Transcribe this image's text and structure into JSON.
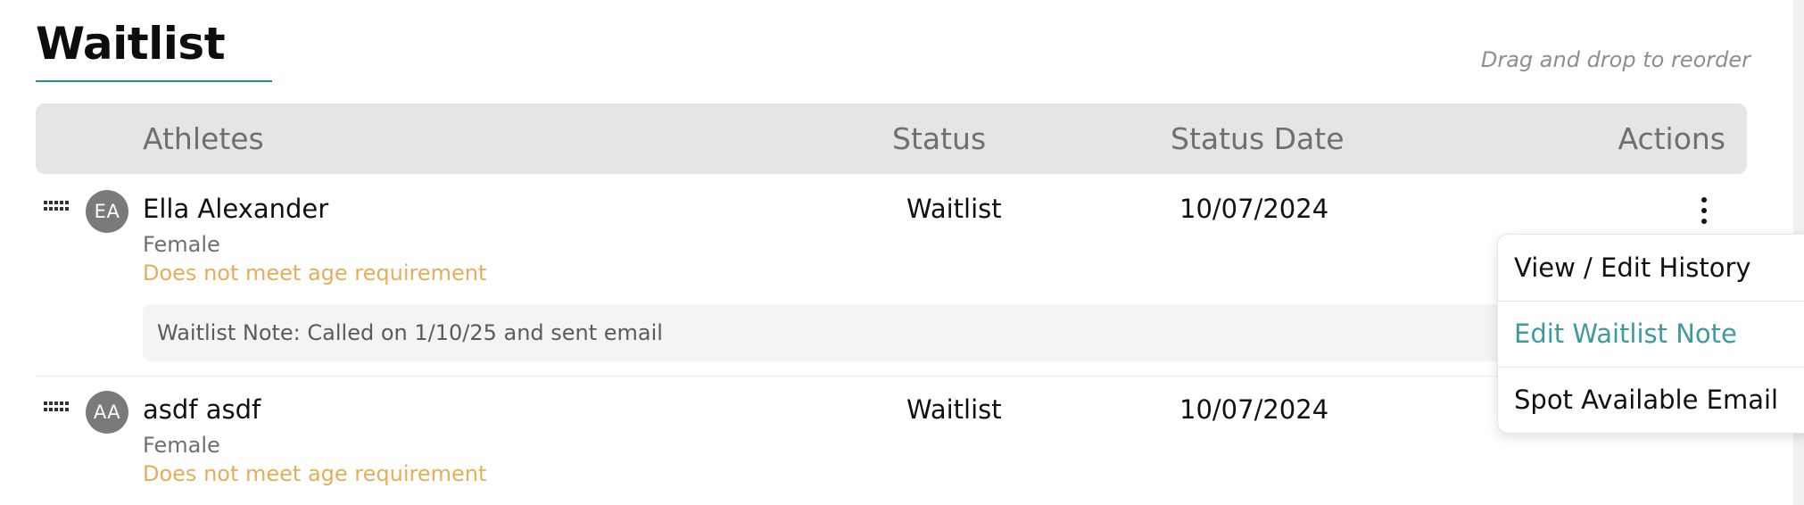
{
  "header": {
    "title": "Waitlist",
    "reorder_hint": "Drag and drop to reorder"
  },
  "table": {
    "columns": {
      "athletes": "Athletes",
      "status": "Status",
      "status_date": "Status Date",
      "actions": "Actions"
    },
    "rows": [
      {
        "initials": "EA",
        "name": "Ella Alexander",
        "gender": "Female",
        "warning": "Does not meet age requirement",
        "status": "Waitlist",
        "status_date": "10/07/2024",
        "note": "Waitlist Note: Called on 1/10/25 and sent email"
      },
      {
        "initials": "AA",
        "name": "asdf asdf",
        "gender": "Female",
        "warning": "Does not meet age requirement",
        "status": "Waitlist",
        "status_date": "10/07/2024"
      }
    ]
  },
  "actions_menu": {
    "items": [
      {
        "label": "View / Edit History"
      },
      {
        "label": "Edit Waitlist Note",
        "highlighted": true
      },
      {
        "label": "Spot Available Email"
      }
    ]
  },
  "colors": {
    "accent": "#2b8a86",
    "menu_highlight": "#3f9a9c",
    "warning": "#e6ad5a",
    "header_bg": "#e5e5e5",
    "avatar_bg": "#7a7a7a"
  },
  "icons": {
    "drag_handle": "drag-handle-icon",
    "actions": "kebab-menu-icon"
  }
}
